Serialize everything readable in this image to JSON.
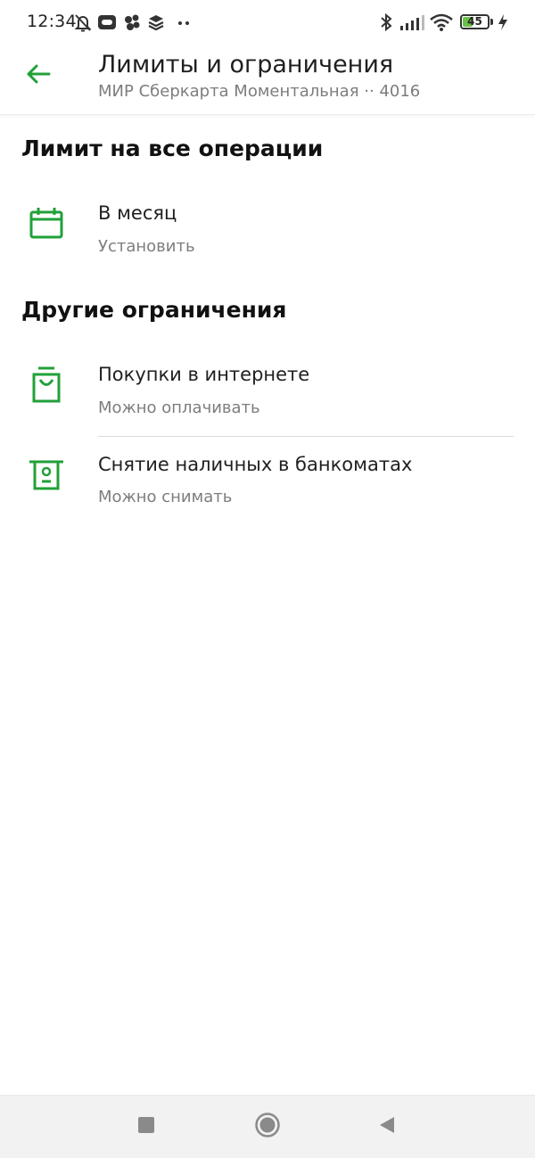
{
  "status_bar": {
    "time": "12:34",
    "battery_level": "45",
    "battery_fraction": 0.45,
    "icons": [
      "bell-off-icon",
      "chat-bubble-icon",
      "dots-app-icon",
      "layers-icon",
      "more-dots-icon",
      "bluetooth-icon",
      "signal-icon",
      "wifi-icon",
      "battery-icon",
      "charging-icon"
    ]
  },
  "app_bar": {
    "back_icon": "arrow-left-icon",
    "title": "Лимиты и ограничения",
    "subtitle": "МИР Сберкарта Моментальная ·· 4016"
  },
  "sections": [
    {
      "title": "Лимит на все операции",
      "items": [
        {
          "icon": "calendar-icon",
          "title": "В месяц",
          "subtitle": "Установить"
        }
      ]
    },
    {
      "title": "Другие ограничения",
      "items": [
        {
          "icon": "shopping-bag-icon",
          "title": "Покупки в интернете",
          "subtitle": "Можно оплачивать"
        },
        {
          "icon": "atm-icon",
          "title": "Снятие наличных в банкоматах",
          "subtitle": "Можно снимать"
        }
      ]
    }
  ],
  "nav_bar": {
    "buttons": [
      "recent-apps-icon",
      "home-icon",
      "back-triangle-icon"
    ]
  },
  "colors": {
    "accent": "#21a038",
    "text_primary": "#1f1f22",
    "text_secondary": "#7d7d80",
    "battery_green": "#6cc04a"
  }
}
